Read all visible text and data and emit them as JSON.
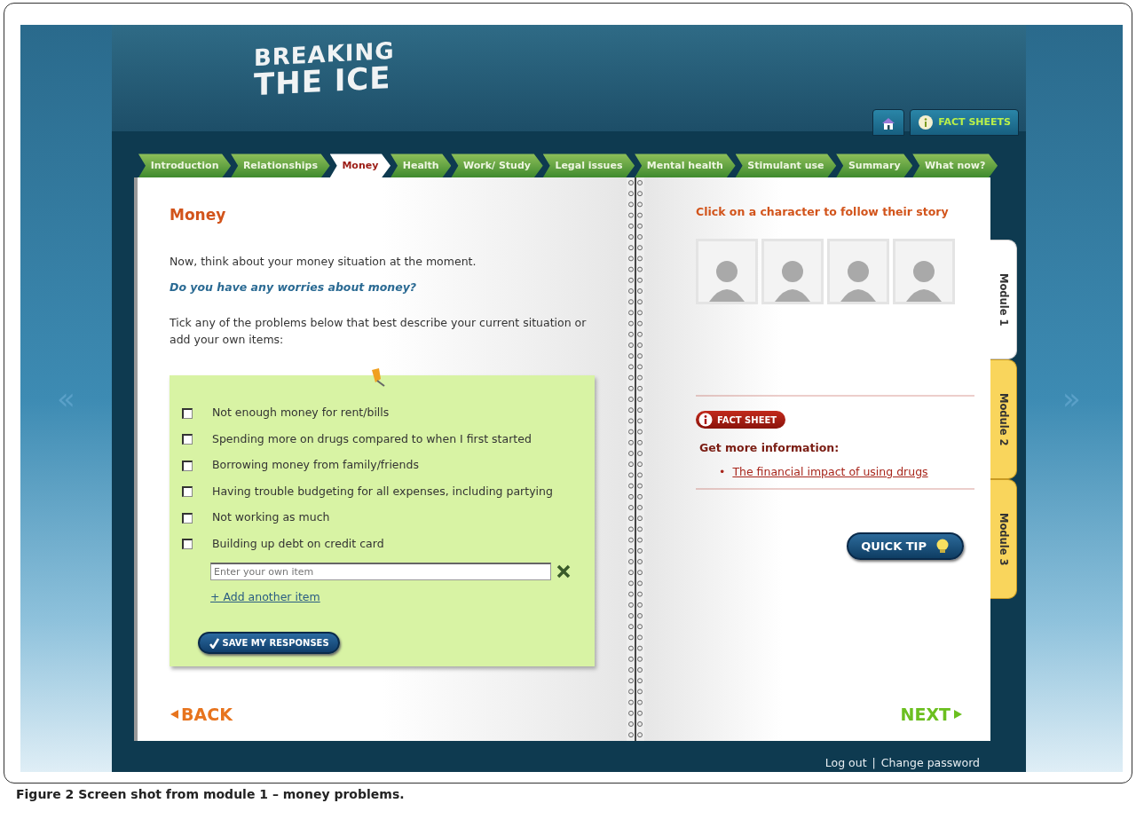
{
  "side_arrows": {
    "previous": "«",
    "next": "»"
  },
  "logo": {
    "lines": [
      "BREAKING",
      "THE ICE"
    ]
  },
  "header_buttons": [
    {
      "kind": "home"
    },
    {
      "kind": "info",
      "label": "FACT SHEETS"
    }
  ],
  "nav_tabs": [
    {
      "label": "Introduction",
      "selected": false
    },
    {
      "label": "Relationships",
      "selected": false
    },
    {
      "label": "Money",
      "selected": true
    },
    {
      "label": "Health",
      "selected": false
    },
    {
      "label": "Work/ Study",
      "selected": false
    },
    {
      "label": "Legal issues",
      "selected": false
    },
    {
      "label": "Mental health",
      "selected": false
    },
    {
      "label": "Stimulant use",
      "selected": false
    },
    {
      "label": "Summary",
      "selected": false
    },
    {
      "label": "What now?",
      "selected": false
    }
  ],
  "left_page": {
    "title": "Money",
    "intro": "Now, think about your money situation at the moment.",
    "question": "Do you have any worries about money?",
    "instruction": "Tick any of the problems below that best describe your current situation or add your own items:",
    "checklist": [
      {
        "label": "Not enough money for rent/bills",
        "checked": false
      },
      {
        "label": "Spending more on drugs compared to when I first started",
        "checked": false
      },
      {
        "label": "Borrowing money from family/friends",
        "checked": false
      },
      {
        "label": "Having trouble budgeting for all expenses, including partying",
        "checked": false
      },
      {
        "label": "Not working as much",
        "checked": false
      },
      {
        "label": "Building up debt on credit card",
        "checked": false
      }
    ],
    "own_item": {
      "placeholder": "Enter your own item"
    },
    "add_link": "+ Add another item",
    "save_button": "SAVE MY RESPONSES",
    "back": "BACK"
  },
  "right_page": {
    "prompt": "Click on a character to follow their story",
    "fact_sheet_badge": "FACT SHEET",
    "more_info": "Get more information:",
    "link_bullet": "•",
    "links": [
      "The financial impact of using drugs"
    ],
    "quick_tip": "QUICK TIP",
    "next": "NEXT"
  },
  "module_tabs": [
    {
      "label": "Module 1",
      "selected": true
    },
    {
      "label": "Module 2",
      "selected": false
    },
    {
      "label": "Module 3",
      "selected": false
    }
  ],
  "footer": {
    "links": [
      "Log out",
      "Change password"
    ],
    "separator": "|"
  },
  "caption": "Figure 2 Screen shot from module 1 – money problems."
}
